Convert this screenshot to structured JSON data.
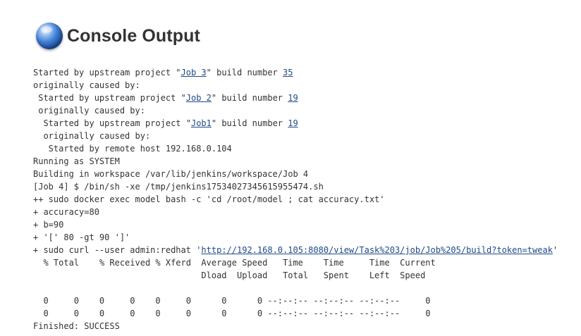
{
  "header": {
    "title": "Console Output",
    "icon": "globe-icon"
  },
  "console": {
    "line1": {
      "prefix": "Started by upstream project \"",
      "link": "Job 3",
      "middle": "\" build number ",
      "build": "35"
    },
    "line2": "originally caused by:",
    "line3": {
      "prefix": " Started by upstream project \"",
      "link": "Job 2",
      "middle": "\" build number ",
      "build": "19"
    },
    "line4": " originally caused by:",
    "line5": {
      "prefix": "  Started by upstream project \"",
      "link": "Job1",
      "middle": "\" build number ",
      "build": "19"
    },
    "line6": "  originally caused by:",
    "line7": "   Started by remote host 192.168.0.104",
    "line8": "Running as SYSTEM",
    "line9": "Building in workspace /var/lib/jenkins/workspace/Job 4",
    "line10": "[Job 4] $ /bin/sh -xe /tmp/jenkins17534027345615955474.sh",
    "line11": "++ sudo docker exec model bash -c 'cd /root/model ; cat accuracy.txt'",
    "line12": "+ accuracy=80",
    "line13": "+ b=90",
    "line14": "+ '[' 80 -gt 90 ']'",
    "line15": {
      "prefix": "+ sudo curl --user admin:redhat '",
      "link": "http://192.168.0.105:8080/view/Task%203/job/Job%205/build?token=tweak",
      "suffix": "'"
    },
    "line16": "  % Total    % Received % Xferd  Average Speed   Time    Time     Time  Current",
    "line17": "                                 Dload  Upload   Total   Spent    Left  Speed",
    "line18": "",
    "line19": "  0     0    0     0    0     0      0      0 --:--:-- --:--:-- --:--:--     0",
    "line20": "  0     0    0     0    0     0      0      0 --:--:-- --:--:-- --:--:--     0",
    "line21": "Finished: SUCCESS"
  }
}
